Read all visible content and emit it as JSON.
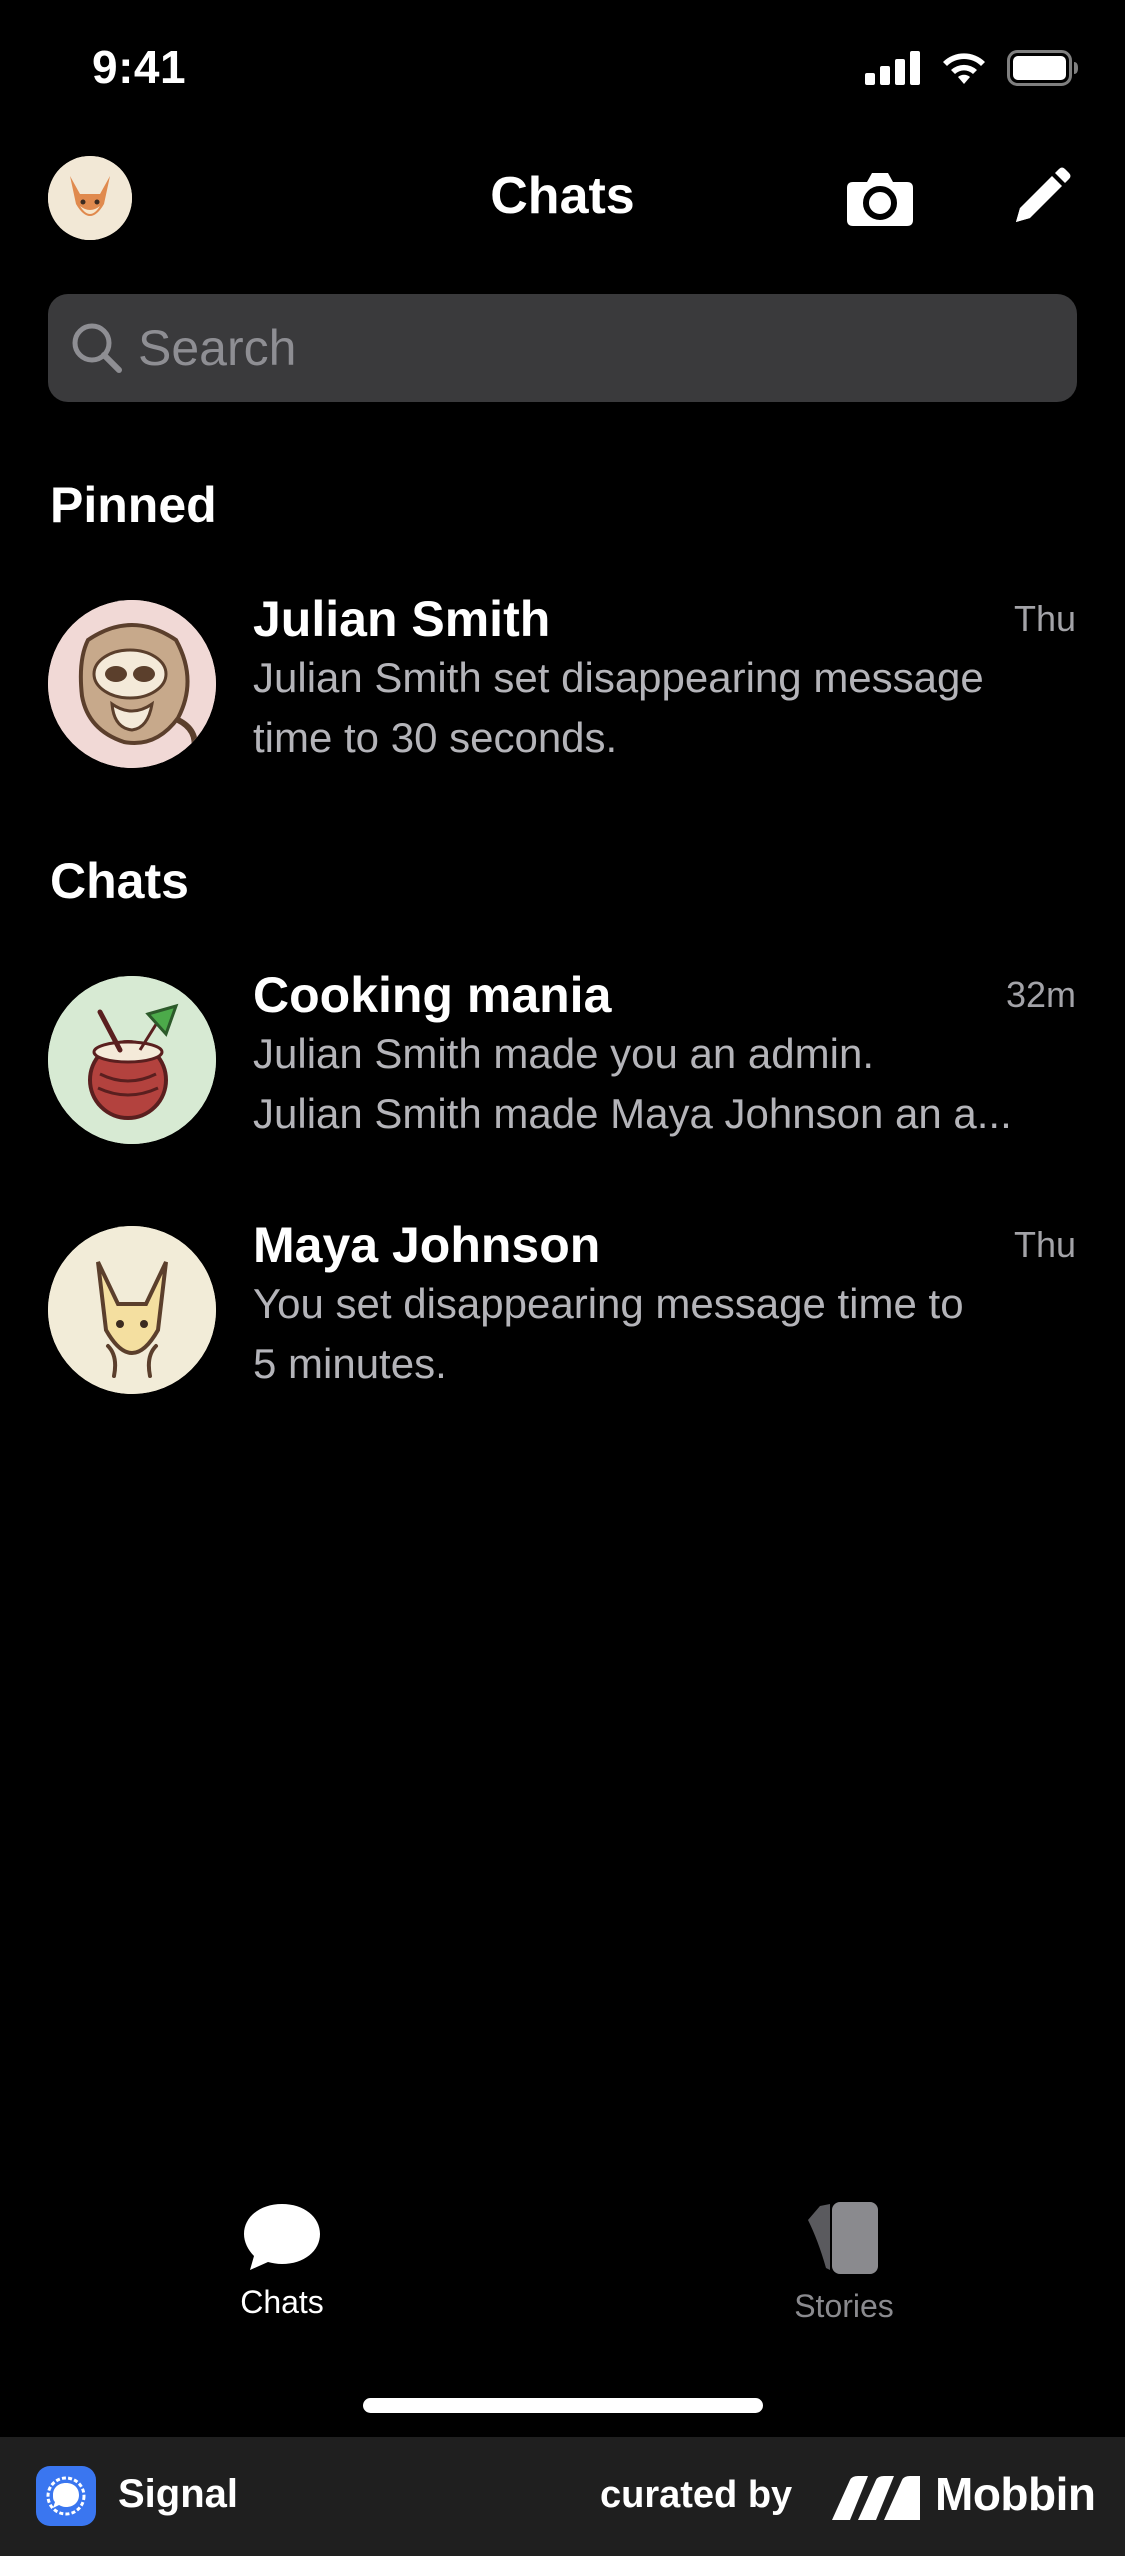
{
  "status_bar": {
    "time": "9:41"
  },
  "header": {
    "title": "Chats",
    "avatar_icon": "fox-avatar-icon",
    "camera_icon": "camera-icon",
    "compose_icon": "pencil-icon"
  },
  "search": {
    "placeholder": "Search"
  },
  "sections": {
    "pinned_title": "Pinned",
    "chats_title": "Chats"
  },
  "pinned": [
    {
      "name": "Julian Smith",
      "time": "Thu",
      "message_line1": "Julian  Smith set disappearing message",
      "message_line2": "time to 30 seconds.",
      "avatar_icon": "sloth-avatar-icon"
    }
  ],
  "chats": [
    {
      "name": "Cooking mania",
      "time": "32m",
      "message_line1": "Julian Smith made you an admin.",
      "message_line2": "Julian Smith made Maya Johnson an a...",
      "avatar_icon": "coconut-drink-avatar-icon"
    },
    {
      "name": "Maya Johnson",
      "time": "Thu",
      "message_line1": "You set disappearing message time to",
      "message_line2": "5 minutes.",
      "avatar_icon": "fox-avatar-icon"
    }
  ],
  "tab_bar": {
    "chats_label": "Chats",
    "stories_label": "Stories",
    "active": "Chats"
  },
  "footer": {
    "app_name": "Signal",
    "curated_by": "curated by",
    "brand": "Mobbin"
  },
  "colors": {
    "background": "#000000",
    "search_bg": "#3a3a3c",
    "secondary_text": "#b4b4b9",
    "inactive_tab": "#8a8a8e",
    "signal_blue": "#3a76f0"
  }
}
